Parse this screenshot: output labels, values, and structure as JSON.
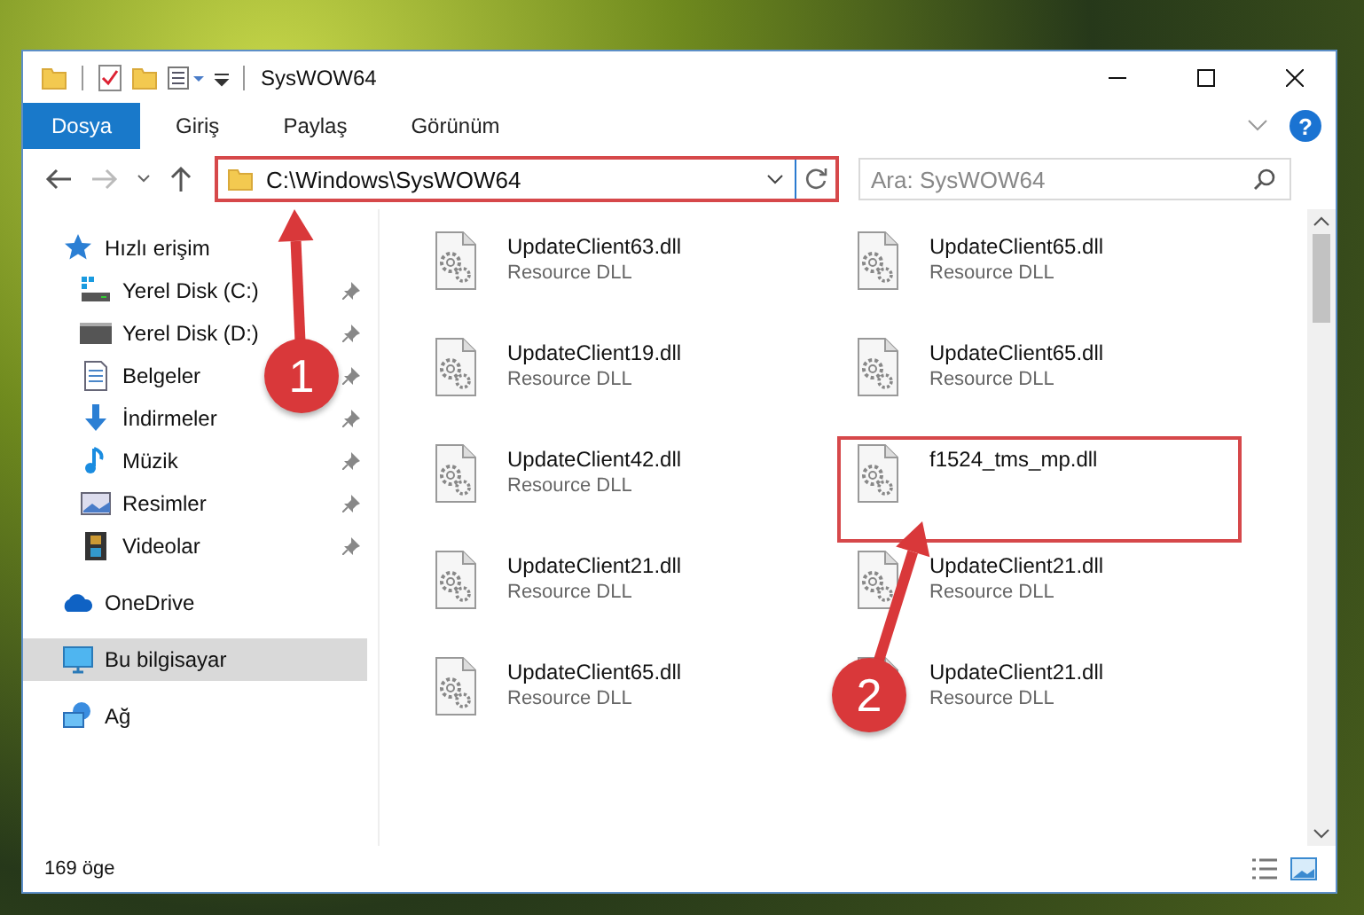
{
  "window": {
    "title": "SysWOW64"
  },
  "ribbon_tabs": [
    {
      "label": "Dosya",
      "selected": true
    },
    {
      "label": "Giriş",
      "selected": false
    },
    {
      "label": "Paylaş",
      "selected": false
    },
    {
      "label": "Görünüm",
      "selected": false
    }
  ],
  "help": "?",
  "address": {
    "path": "C:\\Windows\\SysWOW64",
    "highlighted": true
  },
  "search": {
    "placeholder": "Ara: SysWOW64"
  },
  "sidebar": {
    "items": [
      {
        "label": "Hızlı erişim",
        "kind": "star",
        "selected": false,
        "children": [
          {
            "label": "Yerel Disk (C:)",
            "kind": "system-drive",
            "selected": false,
            "pinned": true
          },
          {
            "label": "Yerel Disk (D:)",
            "kind": "drive",
            "selected": false,
            "pinned": true
          },
          {
            "label": "Belgeler",
            "kind": "documents",
            "selected": false,
            "pinned": true
          },
          {
            "label": "İndirmeler",
            "kind": "download",
            "selected": false,
            "pinned": true
          },
          {
            "label": "Müzik",
            "kind": "music",
            "selected": false,
            "pinned": true
          },
          {
            "label": "Resimler",
            "kind": "pictures",
            "selected": false,
            "pinned": true
          },
          {
            "label": "Videolar",
            "kind": "videos",
            "selected": false,
            "pinned": true
          }
        ]
      },
      {
        "label": "OneDrive",
        "kind": "cloud",
        "selected": false
      },
      {
        "label": "Bu bilgisayar",
        "kind": "computer",
        "selected": true
      },
      {
        "label": "Ağ",
        "kind": "network",
        "selected": false
      }
    ]
  },
  "files": [
    {
      "name": "UpdateClient63.dll",
      "type": "Resource DLL",
      "highlighted": false
    },
    {
      "name": "UpdateClient65.dll",
      "type": "Resource DLL",
      "highlighted": false
    },
    {
      "name": "UpdateClient19.dll",
      "type": "Resource DLL",
      "highlighted": false
    },
    {
      "name": "UpdateClient65.dll",
      "type": "Resource DLL",
      "highlighted": false
    },
    {
      "name": "UpdateClient42.dll",
      "type": "Resource DLL",
      "highlighted": false
    },
    {
      "name": "f1524_tms_mp.dll",
      "highlighted": true
    },
    {
      "name": "UpdateClient21.dll",
      "type": "Resource DLL",
      "highlighted": false
    },
    {
      "name": "UpdateClient21.dll",
      "type": "Resource DLL",
      "highlighted": false
    },
    {
      "name": "UpdateClient65.dll",
      "type": "Resource DLL",
      "highlighted": false
    },
    {
      "name": "UpdateClient21.dll",
      "type": "Resource DLL",
      "highlighted": false
    }
  ],
  "status_bar": {
    "item_count": "169 öge"
  },
  "annotations": [
    {
      "number": "1"
    },
    {
      "number": "2"
    }
  ]
}
